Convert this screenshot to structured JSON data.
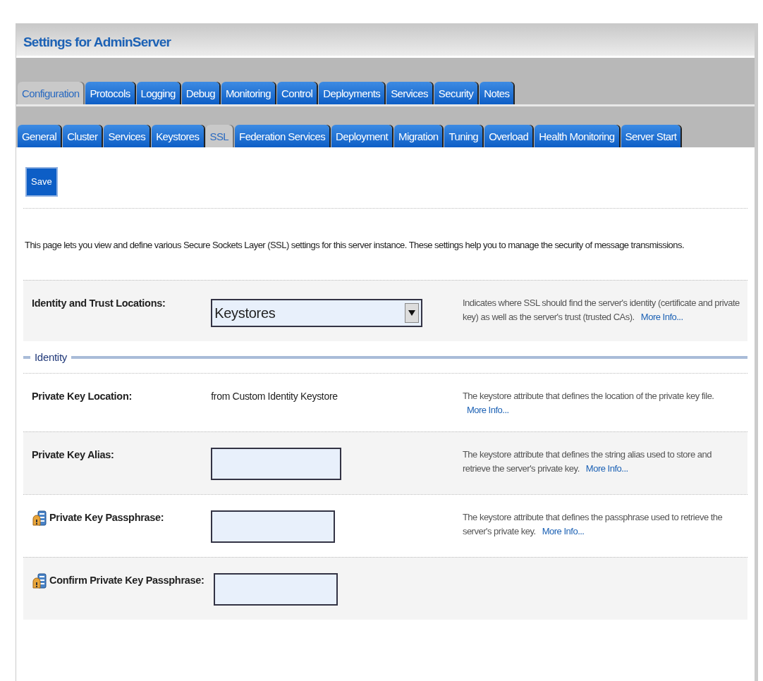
{
  "panel": {
    "title": "Settings for AdminServer"
  },
  "tabs": [
    {
      "label": "Configuration",
      "selected": true
    },
    {
      "label": "Protocols",
      "selected": false
    },
    {
      "label": "Logging",
      "selected": false
    },
    {
      "label": "Debug",
      "selected": false
    },
    {
      "label": "Monitoring",
      "selected": false
    },
    {
      "label": "Control",
      "selected": false
    },
    {
      "label": "Deployments",
      "selected": false
    },
    {
      "label": "Services",
      "selected": false
    },
    {
      "label": "Security",
      "selected": false
    },
    {
      "label": "Notes",
      "selected": false
    }
  ],
  "subtabs": [
    {
      "label": "General",
      "selected": false
    },
    {
      "label": "Cluster",
      "selected": false
    },
    {
      "label": "Services",
      "selected": false
    },
    {
      "label": "Keystores",
      "selected": false
    },
    {
      "label": "SSL",
      "selected": true
    },
    {
      "label": "Federation Services",
      "selected": false
    },
    {
      "label": "Deployment",
      "selected": false
    },
    {
      "label": "Migration",
      "selected": false
    },
    {
      "label": "Tuning",
      "selected": false
    },
    {
      "label": "Overload",
      "selected": false
    },
    {
      "label": "Health Monitoring",
      "selected": false
    },
    {
      "label": "Server Start",
      "selected": false
    }
  ],
  "save_button": "Save",
  "intro": "This page lets you view and define various Secure Sockets Layer (SSL) settings for this server instance. These settings help you to manage the security of message transmissions.",
  "sections": [
    {
      "kind": "plain",
      "rows": [
        {
          "kind": "select",
          "label": "Identity and Trust Locations:",
          "secured": false,
          "value": "Keystores",
          "description": "Indicates where SSL should find the server's identity (certificate and private key) as well as the server's trust (trusted CAs).",
          "link": "More Info..."
        }
      ]
    },
    {
      "kind": "legend",
      "legend": "Identity",
      "rows": [
        {
          "kind": "text",
          "label": "Private Key Location:",
          "secured": false,
          "value": "from Custom Identity Keystore",
          "description": "The keystore attribute that defines the location of the private key file.",
          "link": "More Info..."
        },
        {
          "kind": "input",
          "label": "Private Key Alias:",
          "secured": false,
          "description": "The keystore attribute that defines the string alias used to store and retrieve the server's private key.",
          "link": "More Info..."
        },
        {
          "kind": "password",
          "label": "Private Key Passphrase:",
          "secured": true,
          "description": "The keystore attribute that defines the passphrase used to retrieve the server's private key.",
          "link": "More Info..."
        },
        {
          "kind": "password",
          "label": "Confirm Private Key Passphrase:",
          "secured": true
        }
      ]
    }
  ]
}
